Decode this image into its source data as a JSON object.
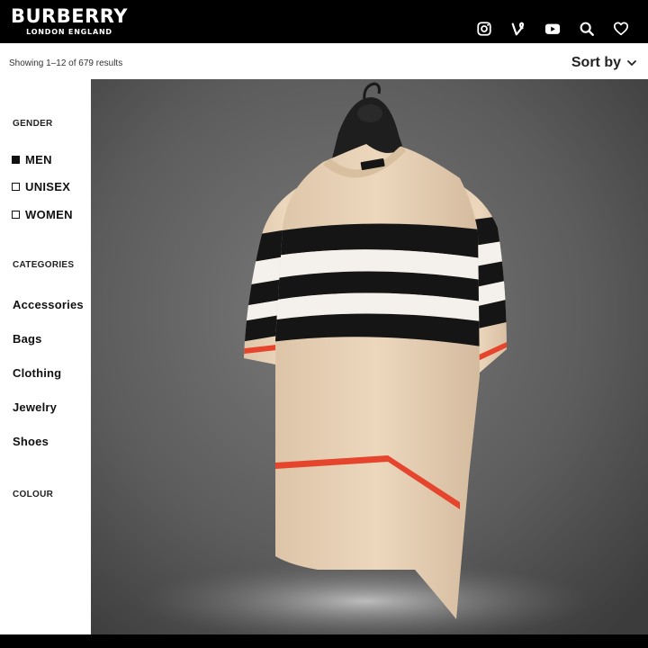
{
  "header": {
    "brand": "BURBERRY",
    "brand_sub": "LONDON ENGLAND",
    "icons": [
      "instagram-icon",
      "vine-icon",
      "youtube-icon",
      "search-icon",
      "heart-icon"
    ]
  },
  "toolbar": {
    "results": "Showing 1–12 of 679 results",
    "sort_label": "Sort by"
  },
  "sidebar": {
    "gender_heading": "GENDER",
    "genders": [
      {
        "label": "MEN",
        "checked": true
      },
      {
        "label": "UNISEX",
        "checked": false
      },
      {
        "label": "WOMEN",
        "checked": false
      }
    ],
    "categories_heading": "CATEGORIES",
    "categories": [
      "Accessories",
      "Bags",
      "Clothing",
      "Jewelry",
      "Shoes"
    ],
    "colour_heading": "COLOUR"
  },
  "product": {
    "image": "striped-knit-tshirt-on-hanger",
    "colors": {
      "knit": "#e8d2b8",
      "black": "#151515",
      "white": "#f4f1ec",
      "red": "#e5452c",
      "backdrop": "#5a5a5a"
    }
  }
}
